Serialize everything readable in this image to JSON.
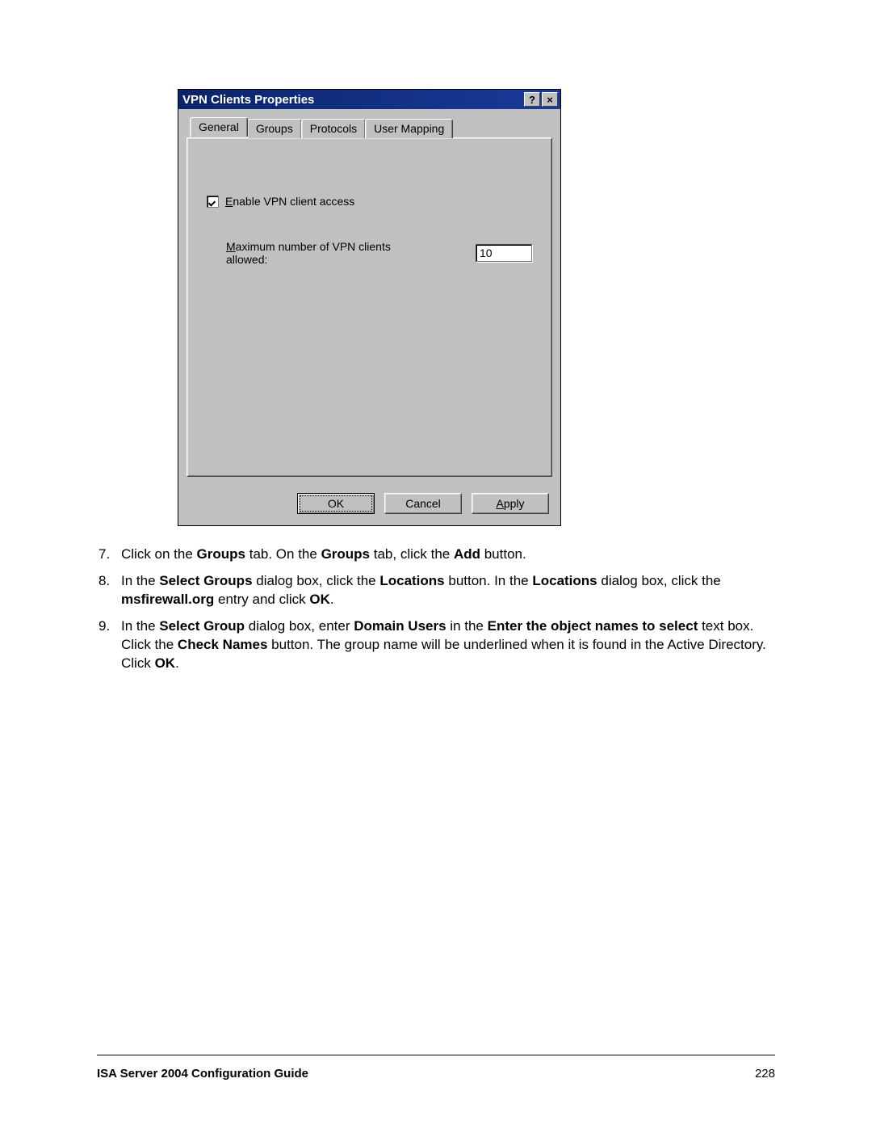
{
  "dialog": {
    "title": "VPN Clients Properties",
    "help_btn": "?",
    "close_btn": "×",
    "tabs": [
      {
        "label": "General",
        "active": true
      },
      {
        "label": "Groups",
        "active": false
      },
      {
        "label": "Protocols",
        "active": false
      },
      {
        "label": "User Mapping",
        "active": false
      }
    ],
    "enable_mnemonic": "E",
    "enable_label_rest": "nable VPN client access",
    "max_mnemonic": "M",
    "max_label_rest": "aximum number of VPN clients allowed:",
    "max_value": "10",
    "ok_label": "OK",
    "cancel_label": "Cancel",
    "apply_mnemonic": "A",
    "apply_rest": "pply"
  },
  "steps": {
    "s7": {
      "num": "7.",
      "p1": "Click on the ",
      "b1": "Groups",
      "p2": " tab. On the ",
      "b2": "Groups",
      "p3": " tab, click the ",
      "b3": "Add",
      "p4": " button."
    },
    "s8": {
      "num": "8.",
      "p1": "In the ",
      "b1": "Select Groups",
      "p2": " dialog box, click the ",
      "b2": "Locations",
      "p3": " button. In the ",
      "b3": "Locations",
      "p4": " dialog box, click the ",
      "b4": "msfirewall.org",
      "p5": " entry and click ",
      "b5": "OK",
      "p6": "."
    },
    "s9": {
      "num": "9.",
      "p1": "In the ",
      "b1": "Select Group",
      "p2": " dialog box, enter ",
      "b2": "Domain Users",
      "p3": " in the ",
      "b3": "Enter the object names to select",
      "p4": " text box. Click the ",
      "b4": "Check Names",
      "p5": " button. The group name will be underlined when it is found in the Active Directory. Click ",
      "b5": "OK",
      "p6": "."
    }
  },
  "footer": {
    "title": "ISA Server 2004 Configuration Guide",
    "page": "228"
  }
}
